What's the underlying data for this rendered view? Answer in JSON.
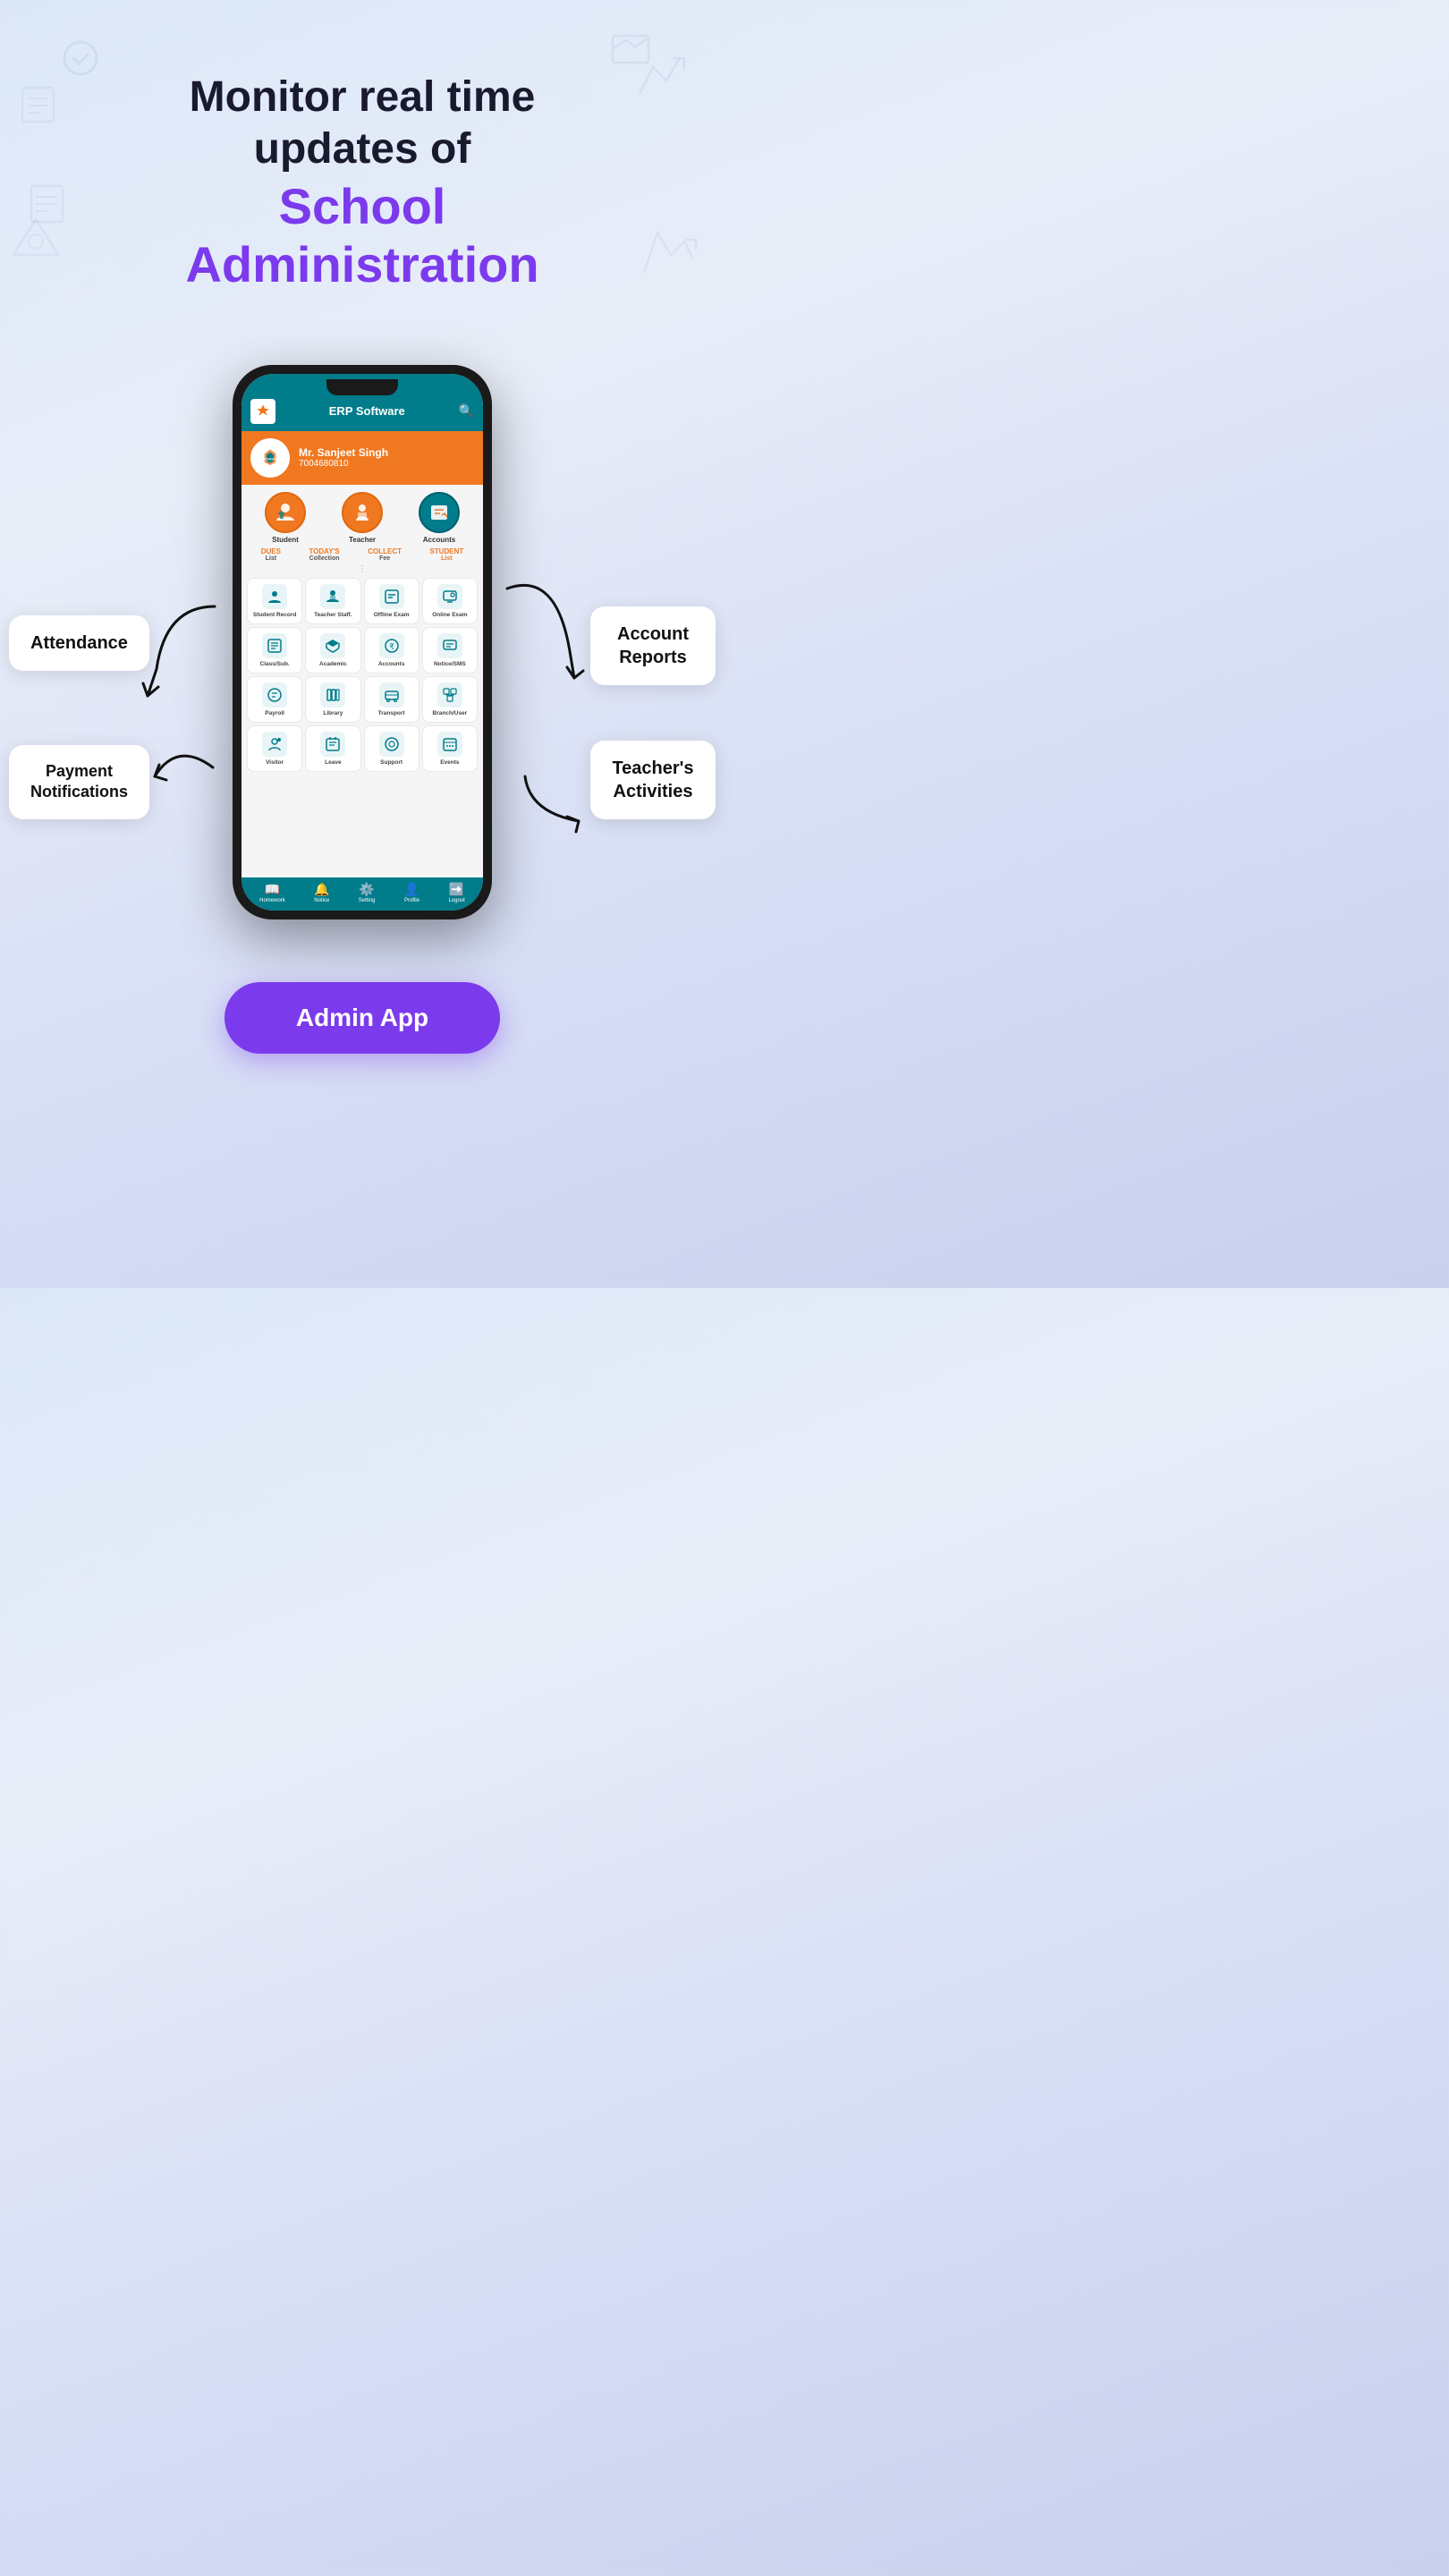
{
  "hero": {
    "line1": "Monitor real time",
    "line2": "updates of",
    "line3": "School",
    "line4": "Administration"
  },
  "app": {
    "title": "ERP Software",
    "user": {
      "name": "Mr. Sanjeet Singh",
      "phone": "7004680810"
    },
    "main_icons": [
      {
        "label": "Student"
      },
      {
        "label": "Teacher"
      },
      {
        "label": "Accounts"
      }
    ],
    "tabs": [
      {
        "value": "DUES",
        "label": "List"
      },
      {
        "value": "TODAY'S",
        "label": "Collection"
      },
      {
        "value": "COLLECT",
        "label": "Fee"
      },
      {
        "value": "STUDENT",
        "label": "List"
      }
    ],
    "menu_items": [
      {
        "icon": "👤",
        "label": "Student Record"
      },
      {
        "icon": "👨‍🏫",
        "label": "Teacher Staff."
      },
      {
        "icon": "📋",
        "label": "Offline Exam"
      },
      {
        "icon": "🖥️",
        "label": "Online Exam"
      },
      {
        "icon": "📑",
        "label": "Class/Sub."
      },
      {
        "icon": "🏛️",
        "label": "Academic"
      },
      {
        "icon": "₹",
        "label": "Accounts"
      },
      {
        "icon": "📱",
        "label": "Notice/SMS"
      },
      {
        "icon": "💰",
        "label": "Payroll"
      },
      {
        "icon": "📚",
        "label": "Library"
      },
      {
        "icon": "🚌",
        "label": "Transport"
      },
      {
        "icon": "🏢",
        "label": "Branch/User"
      },
      {
        "icon": "👁️",
        "label": "Visitor"
      },
      {
        "icon": "📝",
        "label": "Leave"
      },
      {
        "icon": "🎧",
        "label": "Support"
      },
      {
        "icon": "📅",
        "label": "Events"
      }
    ],
    "bottom_nav": [
      {
        "icon": "📖",
        "label": "Homework"
      },
      {
        "icon": "🔔",
        "label": "Notice"
      },
      {
        "icon": "⚙️",
        "label": "Setting"
      },
      {
        "icon": "👤",
        "label": "Profile"
      },
      {
        "icon": "⬛",
        "label": "Logout"
      }
    ]
  },
  "labels": {
    "attendance": "Attendance",
    "payment_notifications": "Payment\nNotifications",
    "account_reports": "Account\nReports",
    "teachers_activities": "Teacher's\nActivities",
    "admin_app": "Admin App"
  }
}
